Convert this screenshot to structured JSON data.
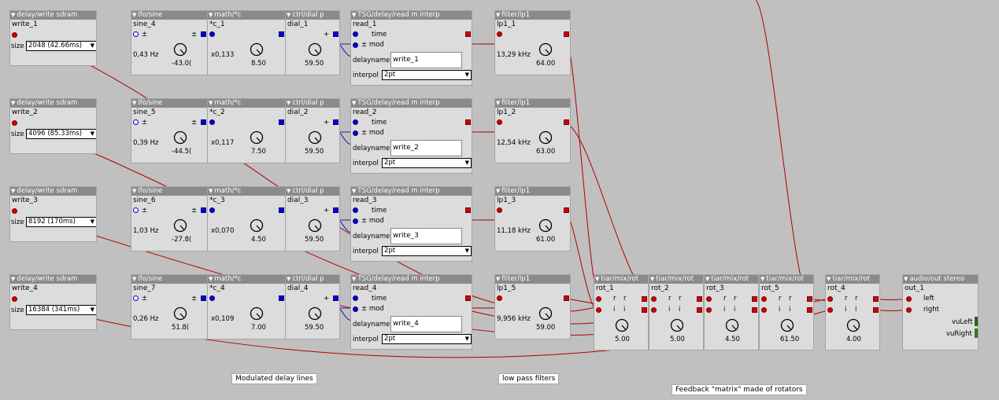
{
  "rows": [
    {
      "write": {
        "type": "delay/write sdram",
        "name": "write_1",
        "size_label": "size",
        "size": "2048 (42.66ms)"
      },
      "lfo": {
        "type": "lfo/sine",
        "name": "sine_4",
        "pm": "±",
        "freq": "0,43 Hz",
        "val": "-43.0("
      },
      "math": {
        "type": "math/*c",
        "name": "*c_1",
        "mul": "x0,133",
        "val": "8.50"
      },
      "dial": {
        "type": "ctrl/dial p",
        "name": "dial_1",
        "plus": "+",
        "val": "59.50"
      },
      "read": {
        "type": "TSG/delay/read m interp",
        "name": "read_1",
        "time": "time",
        "mod": "± mod",
        "delayname_label": "delayname",
        "delayname": "write_1",
        "interp_label": "interpol",
        "interp": "2pt"
      },
      "filter": {
        "type": "filter/lp1",
        "name": "lp1_1",
        "freq": "13,29 kHz",
        "val": "64.00"
      }
    },
    {
      "write": {
        "type": "delay/write sdram",
        "name": "write_2",
        "size_label": "size",
        "size": "4096 (85.33ms)"
      },
      "lfo": {
        "type": "lfo/sine",
        "name": "sine_5",
        "pm": "±",
        "freq": "0,39 Hz",
        "val": "-44.5("
      },
      "math": {
        "type": "math/*c",
        "name": "*c_2",
        "mul": "x0,117",
        "val": "7.50"
      },
      "dial": {
        "type": "ctrl/dial p",
        "name": "dial_2",
        "plus": "+",
        "val": "59.50"
      },
      "read": {
        "type": "TSG/delay/read m interp",
        "name": "read_2",
        "time": "time",
        "mod": "± mod",
        "delayname_label": "delayname",
        "delayname": "write_2",
        "interp_label": "interpol",
        "interp": "2pt"
      },
      "filter": {
        "type": "filter/lp1",
        "name": "lp1_2",
        "freq": "12,54 kHz",
        "val": "63.00"
      }
    },
    {
      "write": {
        "type": "delay/write sdram",
        "name": "write_3",
        "size_label": "size",
        "size": "8192 (170ms)"
      },
      "lfo": {
        "type": "lfo/sine",
        "name": "sine_6",
        "pm": "±",
        "freq": "1,03 Hz",
        "val": "-27.8("
      },
      "math": {
        "type": "math/*c",
        "name": "*c_3",
        "mul": "x0,070",
        "val": "4.50"
      },
      "dial": {
        "type": "ctrl/dial p",
        "name": "dial_3",
        "plus": "+",
        "val": "59.50"
      },
      "read": {
        "type": "TSG/delay/read m interp",
        "name": "read_3",
        "time": "time",
        "mod": "± mod",
        "delayname_label": "delayname",
        "delayname": "write_3",
        "interp_label": "interpol",
        "interp": "2pt"
      },
      "filter": {
        "type": "filter/lp1",
        "name": "lp1_3",
        "freq": "11,18 kHz",
        "val": "61.00"
      }
    },
    {
      "write": {
        "type": "delay/write sdram",
        "name": "write_4",
        "size_label": "size",
        "size": "16384 (341ms)"
      },
      "lfo": {
        "type": "lfo/sine",
        "name": "sine_7",
        "pm": "±",
        "freq": "0,26 Hz",
        "val": "51.8("
      },
      "math": {
        "type": "math/*c",
        "name": "*c_4",
        "mul": "x0,109",
        "val": "7.00"
      },
      "dial": {
        "type": "ctrl/dial p",
        "name": "dial_4",
        "plus": "+",
        "val": "59.50"
      },
      "read": {
        "type": "TSG/delay/read m interp",
        "name": "read_4",
        "time": "time",
        "mod": "± mod",
        "delayname_label": "delayname",
        "delayname": "write_4",
        "interp_label": "interpol",
        "interp": "2pt"
      },
      "filter": {
        "type": "filter/lp1",
        "name": "lp1_5",
        "freq": "9,956 kHz",
        "val": "59.00"
      }
    }
  ],
  "rotators": [
    {
      "type": "tiar/mix/rot",
      "name": "rot_1",
      "r": "r",
      "i": "i",
      "val": "5.00"
    },
    {
      "type": "tiar/mix/rot",
      "name": "rot_2",
      "r": "r",
      "i": "i",
      "val": "5.00"
    },
    {
      "type": "tiar/mix/rot",
      "name": "rot_3",
      "r": "r",
      "i": "i",
      "val": "4.50"
    },
    {
      "type": "tiar/mix/rot",
      "name": "rot_5",
      "r": "r",
      "i": "i",
      "val": "61.50"
    },
    {
      "type": "tiar/mix/rot",
      "name": "rot_4",
      "r": "r",
      "i": "i",
      "val": "4.00"
    }
  ],
  "out": {
    "type": "audio/out stereo",
    "name": "out_1",
    "left": "left",
    "right": "right",
    "vuleft": "vuLeft",
    "vuright": "vuRight"
  },
  "notes": {
    "delay": "Modulated delay lines",
    "lp": "low pass filters",
    "matrix": "Feedback \"matrix\" made of rotators"
  },
  "colors": {
    "wire_audio": "#b00000",
    "wire_control": "#2020b0",
    "title_bar": "#8a8a8a",
    "canvas": "#c0c0c0"
  }
}
